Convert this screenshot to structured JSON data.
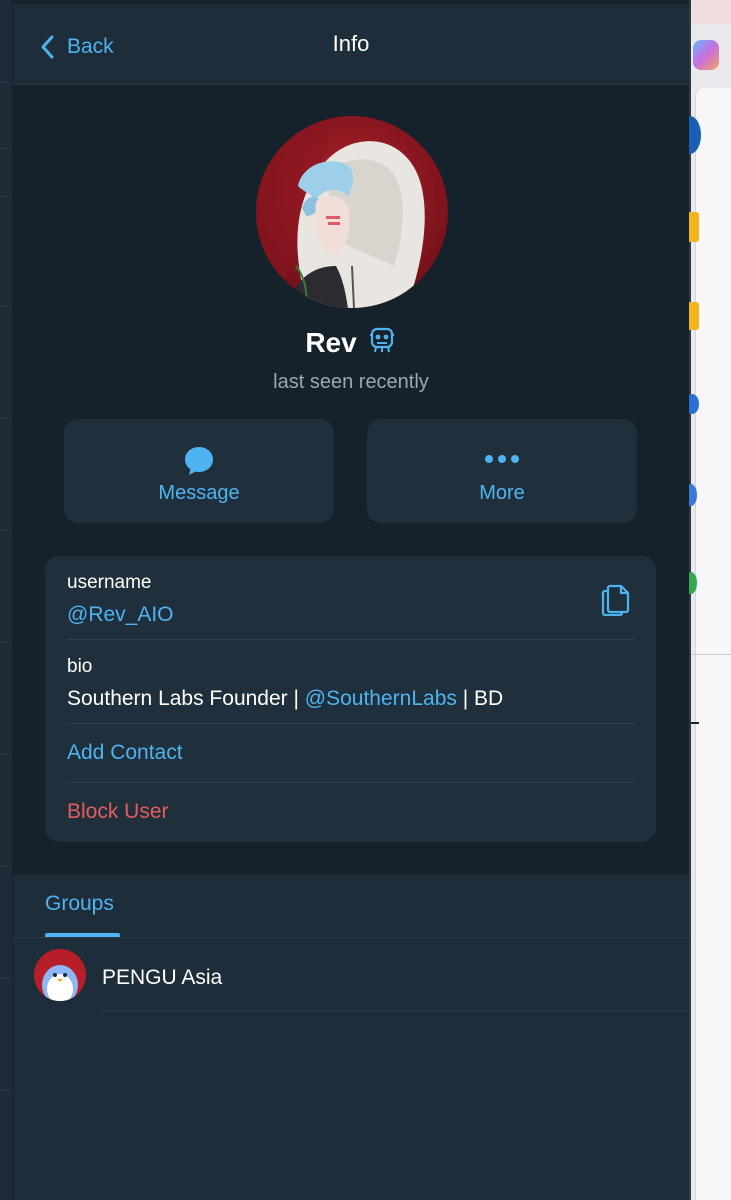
{
  "header": {
    "back_label": "Back",
    "title": "Info"
  },
  "profile": {
    "name": "Rev",
    "status": "last seen recently"
  },
  "actions": {
    "message_label": "Message",
    "more_label": "More"
  },
  "info": {
    "username_label": "username",
    "username_value": "@Rev_AIO",
    "bio_label": "bio",
    "bio_prefix": "Southern Labs Founder | ",
    "bio_mention": "@SouthernLabs",
    "bio_suffix": " | BD",
    "add_contact_label": "Add Contact",
    "block_user_label": "Block User"
  },
  "tabs": {
    "groups_label": "Groups"
  },
  "groups": [
    {
      "name": "PENGU Asia"
    }
  ],
  "colors": {
    "accent": "#4eb3f0",
    "danger": "#e35d5d",
    "panel_bg": "#15222b",
    "card_bg": "#1f303c"
  }
}
